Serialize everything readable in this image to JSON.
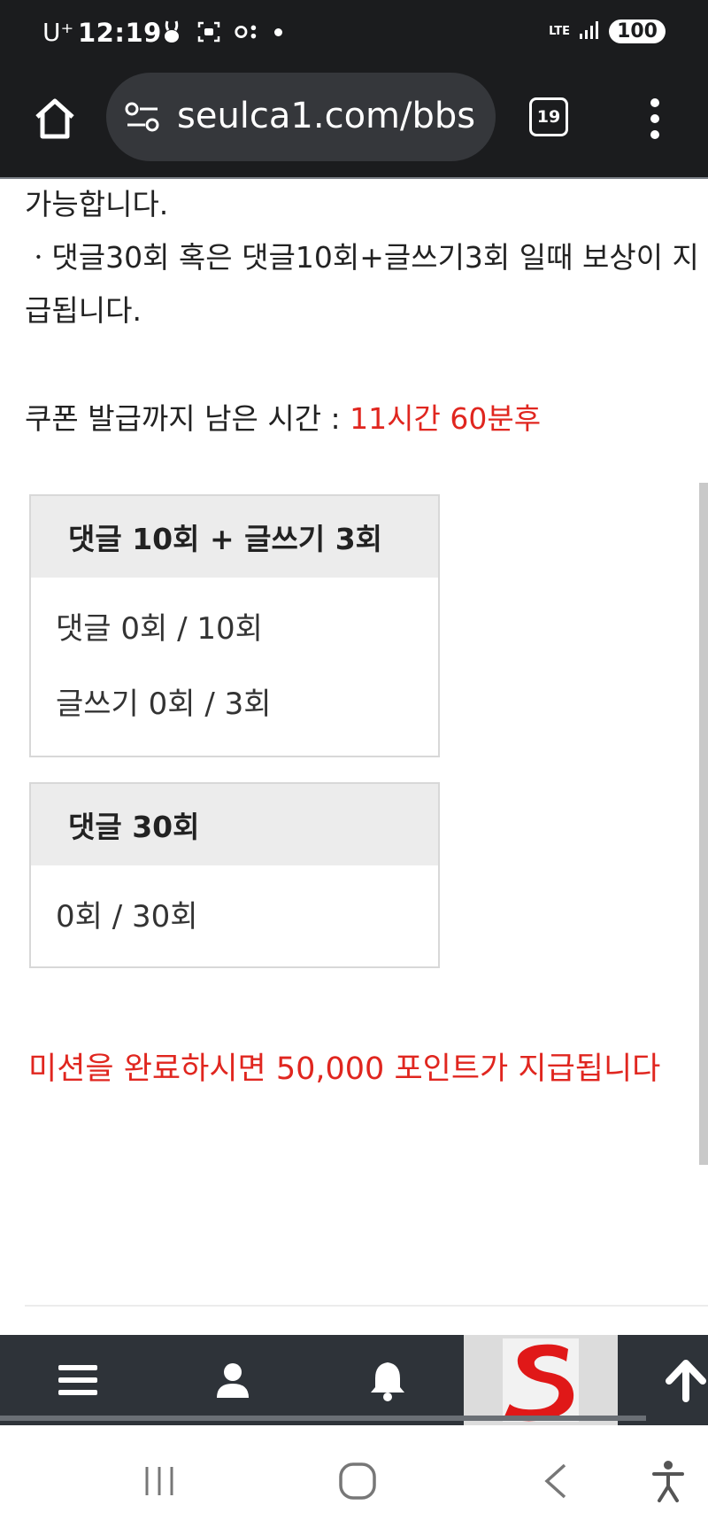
{
  "status_bar": {
    "carrier": "U⁺",
    "time": "12:19",
    "network": "LTE",
    "battery": "100"
  },
  "browser": {
    "url": "seulca1.com/bbs",
    "tab_count": "19"
  },
  "content": {
    "line1": "가능합니다.",
    "line2": "ㆍ댓글30회 혹은 댓글10회+글쓰기3회 일때 보상이 지",
    "line3": "급됩니다.",
    "timer_label": "쿠폰 발급까지 남은 시간 : ",
    "timer_value": "11시간 60분후"
  },
  "mission_box_1": {
    "title": "댓글 10회 + 글쓰기 3회",
    "comment_progress": "댓글 0회 / 10회",
    "post_progress": "글쓰기 0회 / 3회"
  },
  "mission_box_2": {
    "title": "댓글 30회",
    "progress": "0회 / 30회"
  },
  "reward_notice": "미션을 완료하시면 50,000 포인트가 지급됩니다",
  "bottom_nav": {
    "items": [
      "menu-icon",
      "user-icon",
      "bell-icon",
      "site-logo",
      "arrow-up-icon"
    ]
  },
  "colors": {
    "accent_red": "#e0261f",
    "browser_bg": "#1b1c1e",
    "nav_bg": "#2e3339"
  }
}
